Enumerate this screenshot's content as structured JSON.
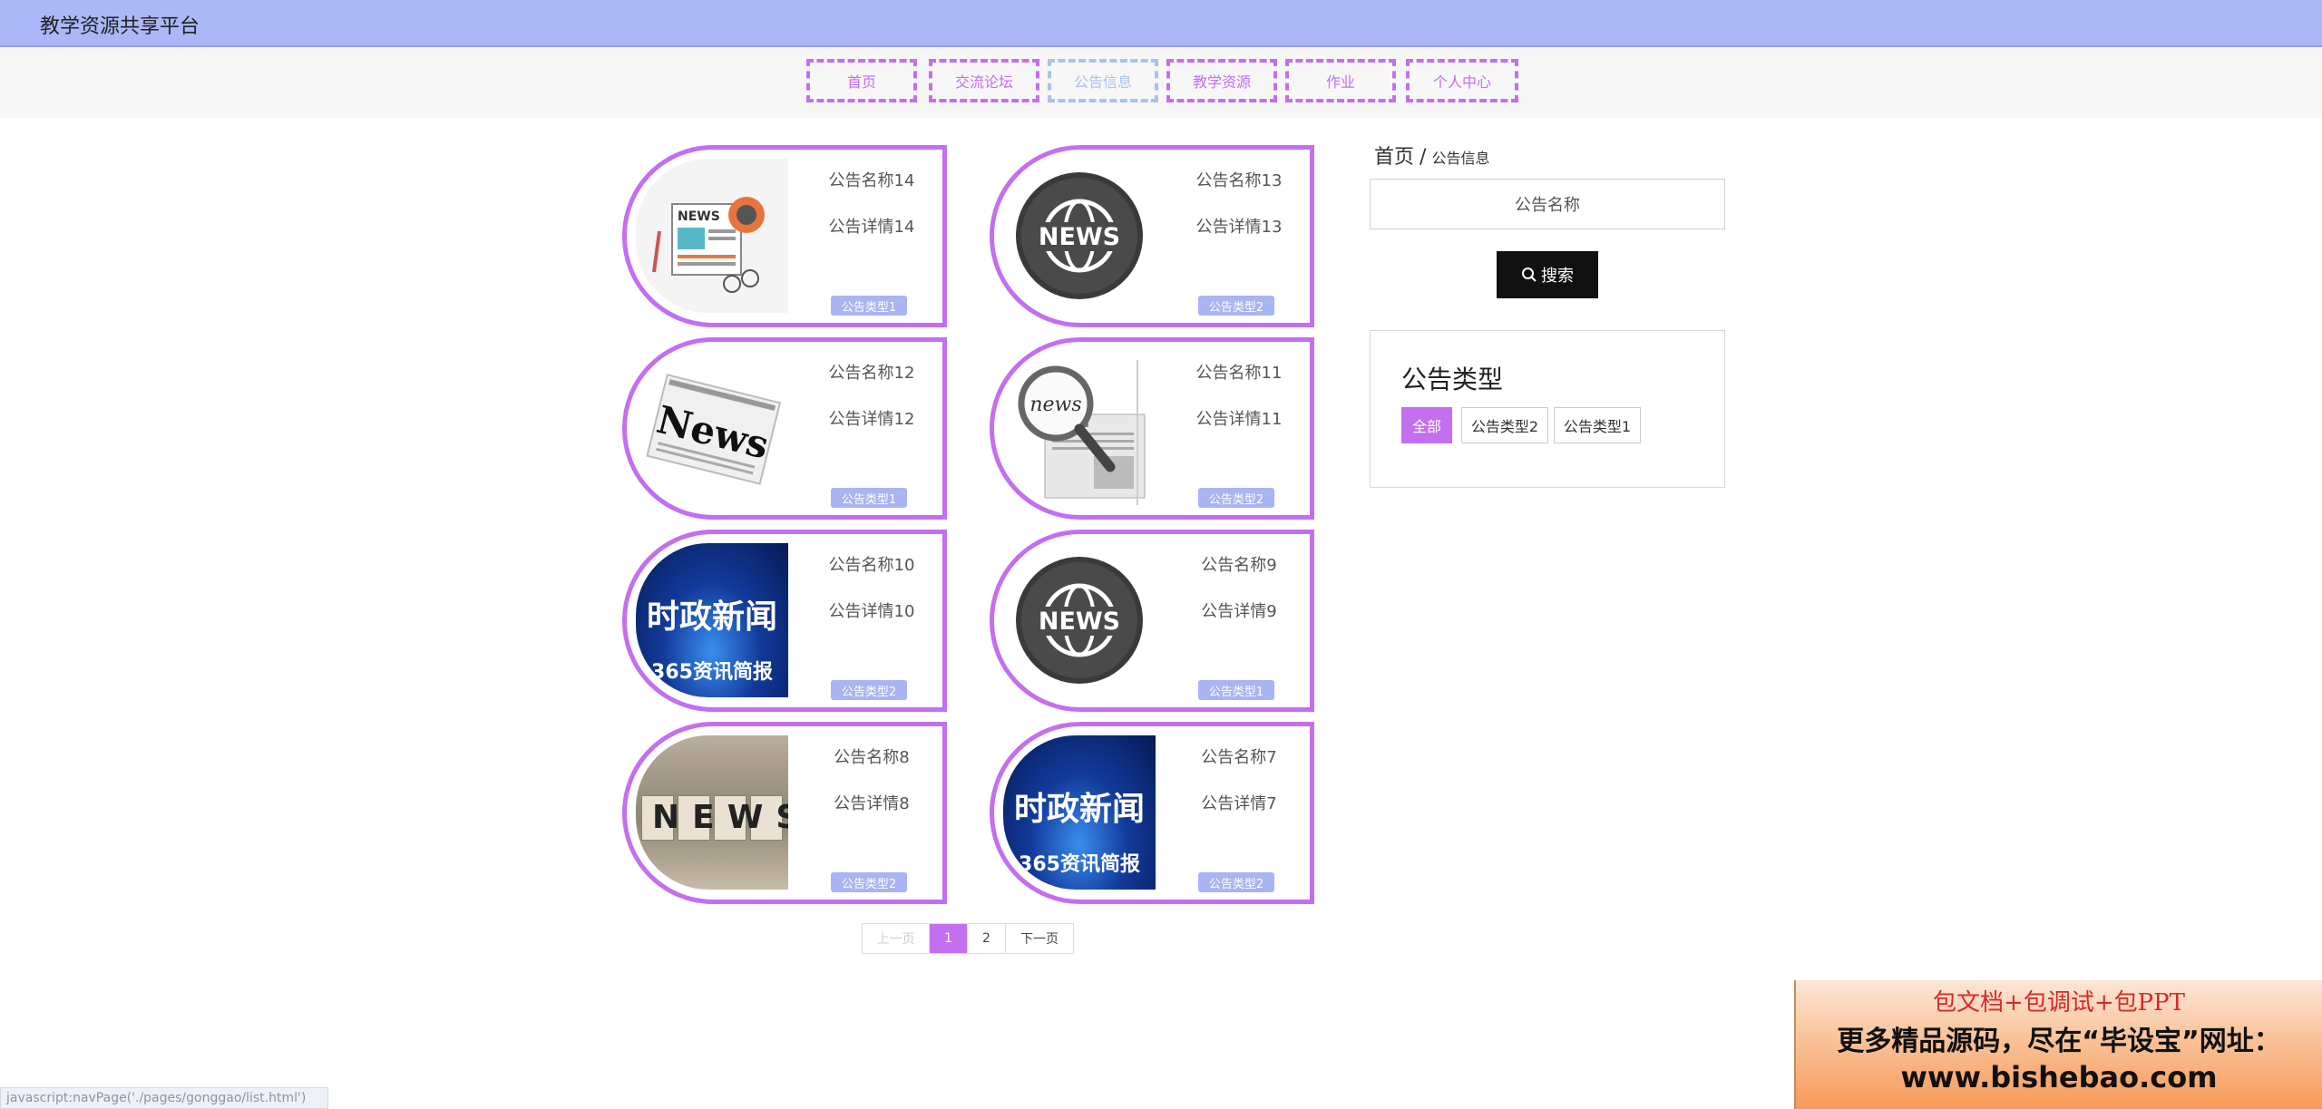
{
  "header": {
    "title": "教学资源共享平台"
  },
  "nav": {
    "items": [
      "首页",
      "交流论坛",
      "公告信息",
      "教学资源",
      "作业",
      "个人中心"
    ]
  },
  "cards": [
    {
      "name": "公告名称14",
      "detail": "公告详情14",
      "type": "公告类型1",
      "image": "news-clipart"
    },
    {
      "name": "公告名称13",
      "detail": "公告详情13",
      "type": "公告类型2",
      "image": "news-globe"
    },
    {
      "name": "公告名称12",
      "detail": "公告详情12",
      "type": "公告类型1",
      "image": "newspaper"
    },
    {
      "name": "公告名称11",
      "detail": "公告详情11",
      "type": "公告类型2",
      "image": "magnifier-news"
    },
    {
      "name": "公告名称10",
      "detail": "公告详情10",
      "type": "公告类型2",
      "image": "shizheng-news",
      "image_text": [
        "时政新闻",
        "365资讯简报"
      ]
    },
    {
      "name": "公告名称9",
      "detail": "公告详情9",
      "type": "公告类型1",
      "image": "news-globe"
    },
    {
      "name": "公告名称8",
      "detail": "公告详情8",
      "type": "公告类型2",
      "image": "news-blocks",
      "image_text": [
        "NEWS"
      ]
    },
    {
      "name": "公告名称7",
      "detail": "公告详情7",
      "type": "公告类型2",
      "image": "shizheng-news",
      "image_text": [
        "时政新闻",
        "365资讯简报"
      ]
    }
  ],
  "pagination": {
    "prev": "上一页",
    "pages": [
      "1",
      "2"
    ],
    "current": "1",
    "next": "下一页"
  },
  "sidebar": {
    "breadcrumb": {
      "home": "首页",
      "separator": "/",
      "current": "公告信息"
    },
    "search_value": "公告名称",
    "search_button": "搜索",
    "type_title": "公告类型",
    "types": [
      "全部",
      "公告类型2",
      "公告类型1"
    ],
    "active_type": "全部"
  },
  "status_link": "javascript:navPage('./pages/gonggao/list.html')",
  "promo": {
    "line1": "包文档+包调试+包PPT",
    "line2": "更多精品源码，尽在“毕设宝”网址：",
    "line3": "www.bishebao.com"
  },
  "colors": {
    "accent": "#c36ff0",
    "header_bg": "#acb7f7",
    "badge": "#a9b4f2"
  }
}
